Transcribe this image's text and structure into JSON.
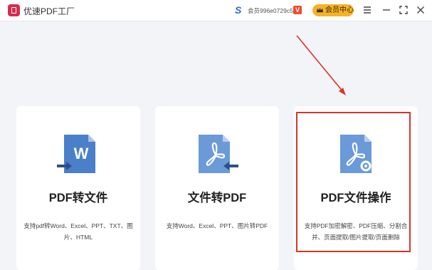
{
  "app": {
    "title": "优速PDF工厂",
    "user_id": "会员996e0729c58b",
    "vip_badge": "V",
    "vip_button": "会员中心"
  },
  "colors": {
    "brand": "#d9294e",
    "vip": "#f5b325",
    "icon_blue": "#4a7fc9",
    "highlight": "#d8342c"
  },
  "cards": [
    {
      "icon": "word-document-icon",
      "title": "PDF转文件",
      "desc": "支持pdf转Word、Excel、PPT、TXT、图片、HTML"
    },
    {
      "icon": "pdf-document-icon",
      "title": "文件转PDF",
      "desc": "支持Word、Excel、PPT、图片转PDF"
    },
    {
      "icon": "pdf-settings-icon",
      "title": "PDF文件操作",
      "desc": "支持PDF加密解密、PDF压缩、分割合并、页面提取/图片提取/页面删除"
    }
  ]
}
